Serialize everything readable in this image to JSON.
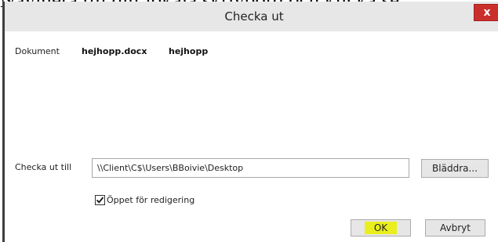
{
  "background_text": "Navigera till ditt lokala skrivbord och klicka se",
  "dialog": {
    "title": "Checka ut",
    "close_label": "x"
  },
  "document": {
    "label": "Dokument",
    "filename": "hejhopp.docx",
    "name": "hejhopp"
  },
  "checkout": {
    "label": "Checka ut till",
    "path": "\\\\Client\\C$\\Users\\BBoivie\\Desktop",
    "browse_label": "Bläddra..."
  },
  "open_for_edit": {
    "label": "Öppet för redigering",
    "checked": true
  },
  "buttons": {
    "ok_label": "OK",
    "cancel_label": "Avbryt"
  },
  "colors": {
    "ok_highlight": "#e9ef1c",
    "close_button": "#c9302c",
    "titlebar": "#e7e7e8"
  }
}
